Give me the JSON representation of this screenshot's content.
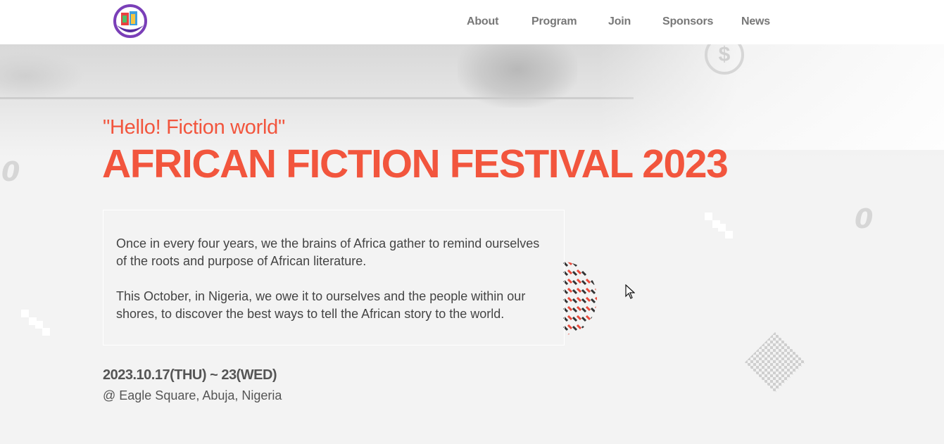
{
  "header": {
    "nav": [
      {
        "label": "About"
      },
      {
        "label": "Program"
      },
      {
        "label": "Join"
      },
      {
        "label": "Sponsors"
      },
      {
        "label": "News"
      }
    ]
  },
  "hero": {
    "tagline": "\"Hello! Fiction world\"",
    "title": "AFRICAN FICTION FESTIVAL 2023",
    "paragraphs": [
      "Once in every four years, we the brains of Africa gather to remind ourselves of the roots and purpose of African literature.",
      "This October, in Nigeria, we owe it to ourselves and the people within our shores, to discover the best ways to tell the African story to the world."
    ],
    "date": "2023.10.17(THU) ~ 23(WED)",
    "venue": "@ Eagle Square, Abuja, Nigeria"
  },
  "decorations": {
    "zero_glyph": "0",
    "coin_glyph": "$"
  },
  "colors": {
    "accent": "#f2553d",
    "text": "#444444",
    "nav_text": "#777777",
    "background": "#f3f3f3"
  }
}
